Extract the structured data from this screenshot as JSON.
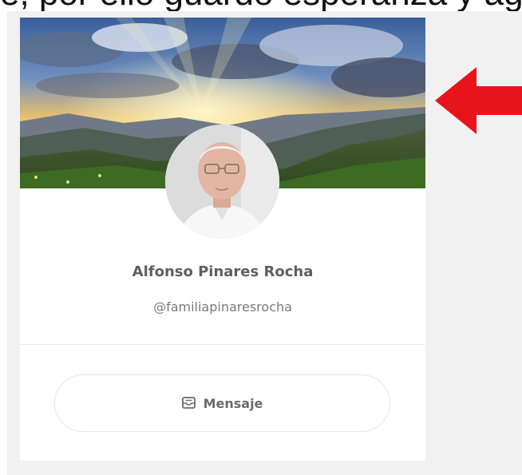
{
  "caption": {
    "text": "e, por ello guardo esperanza y agradezco"
  },
  "profile": {
    "name": "Alfonso Pinares Rocha",
    "handle": "@familiapinaresrocha"
  },
  "actions": {
    "message_label": "Mensaje"
  },
  "icons": {
    "message": "message-icon",
    "arrow": "red-arrow-icon"
  },
  "colors": {
    "arrow": "#e8141b",
    "page_background": "#f1f1f1",
    "card_background": "#ffffff",
    "name_text": "#5f5f5f",
    "handle_text": "#7a7a7a"
  }
}
